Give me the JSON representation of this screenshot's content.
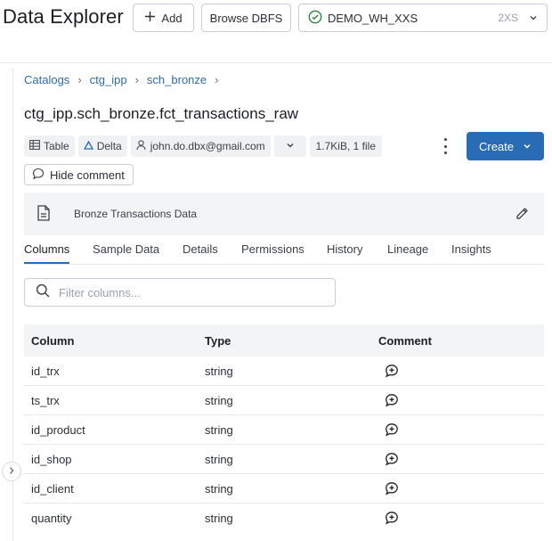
{
  "header": {
    "title": "Data Explorer",
    "add_label": "Add",
    "browse_label": "Browse DBFS",
    "warehouse": {
      "name": "DEMO_WH_XXS",
      "size": "2XS",
      "status": "running"
    }
  },
  "breadcrumb": {
    "items": [
      "Catalogs",
      "ctg_ipp",
      "sch_bronze"
    ]
  },
  "table_title": "ctg_ipp.sch_bronze.fct_transactions_raw",
  "meta": {
    "type": "Table",
    "format": "Delta",
    "owner": "john.do.dbx@gmail.com",
    "size": "1.7KiB, 1 file"
  },
  "create_label": "Create",
  "hide_comment_label": "Hide comment",
  "comment": "Bronze Transactions Data",
  "tabs": [
    {
      "label": "Columns",
      "active": true
    },
    {
      "label": "Sample Data"
    },
    {
      "label": "Details"
    },
    {
      "label": "Permissions"
    },
    {
      "label": "History"
    },
    {
      "label": "Lineage"
    },
    {
      "label": "Insights"
    }
  ],
  "filter": {
    "placeholder": "Filter columns..."
  },
  "columns_table": {
    "headers": [
      "Column",
      "Type",
      "Comment"
    ],
    "rows": [
      {
        "column": "id_trx",
        "type": "string"
      },
      {
        "column": "ts_trx",
        "type": "string"
      },
      {
        "column": "id_product",
        "type": "string"
      },
      {
        "column": "id_shop",
        "type": "string"
      },
      {
        "column": "id_client",
        "type": "string"
      },
      {
        "column": "quantity",
        "type": "string"
      }
    ]
  },
  "colors": {
    "accent": "#2a6bb5",
    "link": "#2f6ca8",
    "success": "#2e8540"
  }
}
